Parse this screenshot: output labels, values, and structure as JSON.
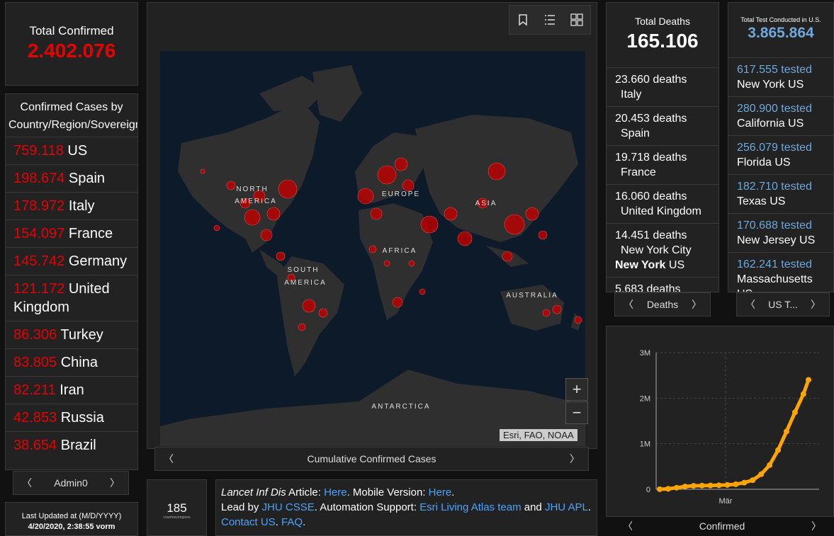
{
  "total_confirmed": {
    "title": "Total Confirmed",
    "value": "2.402.076"
  },
  "country_list": {
    "header": "Confirmed Cases by Country/Region/Sovereignty",
    "items": [
      {
        "value": "759.118",
        "name": "US"
      },
      {
        "value": "198.674",
        "name": "Spain"
      },
      {
        "value": "178.972",
        "name": "Italy"
      },
      {
        "value": "154.097",
        "name": "France"
      },
      {
        "value": "145.742",
        "name": "Germany"
      },
      {
        "value": "121.172",
        "name": "United Kingdom"
      },
      {
        "value": "86.306",
        "name": "Turkey"
      },
      {
        "value": "83.805",
        "name": "China"
      },
      {
        "value": "82.211",
        "name": "Iran"
      },
      {
        "value": "42.853",
        "name": "Russia"
      },
      {
        "value": "38.654",
        "name": "Brazil"
      }
    ],
    "pager_label": "Admin0"
  },
  "map": {
    "labels": {
      "north_america": "NORTH\nAMERICA",
      "south_america": "SOUTH\nAMERICA",
      "europe": "EUROPE",
      "africa": "AFRICA",
      "asia": "ASIA",
      "australia": "AUSTRALIA",
      "antarctica": "ANTARCTICA"
    },
    "attribution": "Esri, FAO, NOAA",
    "zoom_in": "+",
    "zoom_out": "−",
    "pager_label": "Cumulative Confirmed Cases"
  },
  "total_deaths": {
    "title": "Total Deaths",
    "value": "165.106",
    "items": [
      {
        "value": "23.660",
        "unit": "deaths",
        "place": "Italy"
      },
      {
        "value": "20.453",
        "unit": "deaths",
        "place": "Spain"
      },
      {
        "value": "19.718",
        "unit": "deaths",
        "place": "France"
      },
      {
        "value": "16.060",
        "unit": "deaths",
        "place": "United Kingdom"
      },
      {
        "value": "14.451",
        "unit": "deaths",
        "place": "New York City",
        "region": "New York",
        "country": "US"
      },
      {
        "value": "5.683",
        "unit": "deaths",
        "place": ""
      }
    ],
    "pager_label": "Deaths"
  },
  "total_tests": {
    "title": "Total Test Conducted in U.S.",
    "value": "3.865.864",
    "items": [
      {
        "value": "617.555",
        "unit": "tested",
        "place": "New York US"
      },
      {
        "value": "280.900",
        "unit": "tested",
        "place": "California US"
      },
      {
        "value": "256.079",
        "unit": "tested",
        "place": "Florida US"
      },
      {
        "value": "182.710",
        "unit": "tested",
        "place": "Texas US"
      },
      {
        "value": "170.688",
        "unit": "tested",
        "place": "New Jersey US"
      },
      {
        "value": "162.241",
        "unit": "tested",
        "place": "Massachusetts US"
      }
    ],
    "pager_label": "US T..."
  },
  "chart_data": {
    "type": "line",
    "title": "",
    "xlabel": "",
    "ylabel": "",
    "ylim": [
      0,
      3000000
    ],
    "y_ticks": [
      "3M",
      "2M",
      "1M",
      "0"
    ],
    "x_ticks": [
      "Mär"
    ],
    "series": [
      {
        "name": "Confirmed",
        "x": [
          0,
          5,
          10,
          15,
          20,
          25,
          30,
          35,
          40,
          45,
          50,
          55,
          60,
          65,
          70,
          75,
          80,
          85,
          88
        ],
        "values": [
          555,
          9927,
          34000,
          60000,
          75000,
          80000,
          83000,
          88000,
          95000,
          110000,
          145000,
          200000,
          330000,
          530000,
          860000,
          1270000,
          1690000,
          2090000,
          2402076
        ]
      }
    ],
    "legend_label": "Confirmed",
    "line_color": "#ffa500"
  },
  "last_updated": {
    "label": "Last Updated at (M/D/YYYY)",
    "value": "4/20/2020, 2:38:55 vorm"
  },
  "country_count": {
    "value": "185",
    "label": "countries/regions"
  },
  "info": {
    "line1_prefix": "Lancet Inf Dis",
    "line1_a": " Article: ",
    "line1_link1": "Here",
    "line1_b": ". Mobile Version: ",
    "line1_link2": "Here",
    "line1_c": ".",
    "line2_a": "Lead by ",
    "line2_link1": "JHU CSSE",
    "line2_b": ". Automation Support: ",
    "line2_link2": "Esri Living Atlas team",
    "line2_c": " and ",
    "line2_link3": "JHU APL",
    "line2_d": ". ",
    "line2_link4": "Contact US",
    "line2_e": ". ",
    "line2_link5": "FAQ",
    "line2_f": "."
  }
}
